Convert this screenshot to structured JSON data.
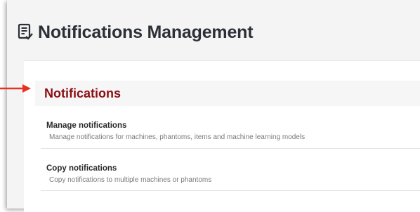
{
  "page": {
    "title": "Notifications Management",
    "title_icon": "notifications-list-icon"
  },
  "section": {
    "title": "Notifications"
  },
  "items": [
    {
      "title": "Manage notifications",
      "description": "Manage notifications for machines, phantoms, items and machine learning models"
    },
    {
      "title": "Copy notifications",
      "description": "Copy notifications to multiple machines or phantoms"
    }
  ],
  "annotation": {
    "pointer": "red-arrow-icon"
  },
  "colors": {
    "section_title": "#8b0e13",
    "arrow": "#e8311f",
    "page_title": "#2b2f36"
  }
}
